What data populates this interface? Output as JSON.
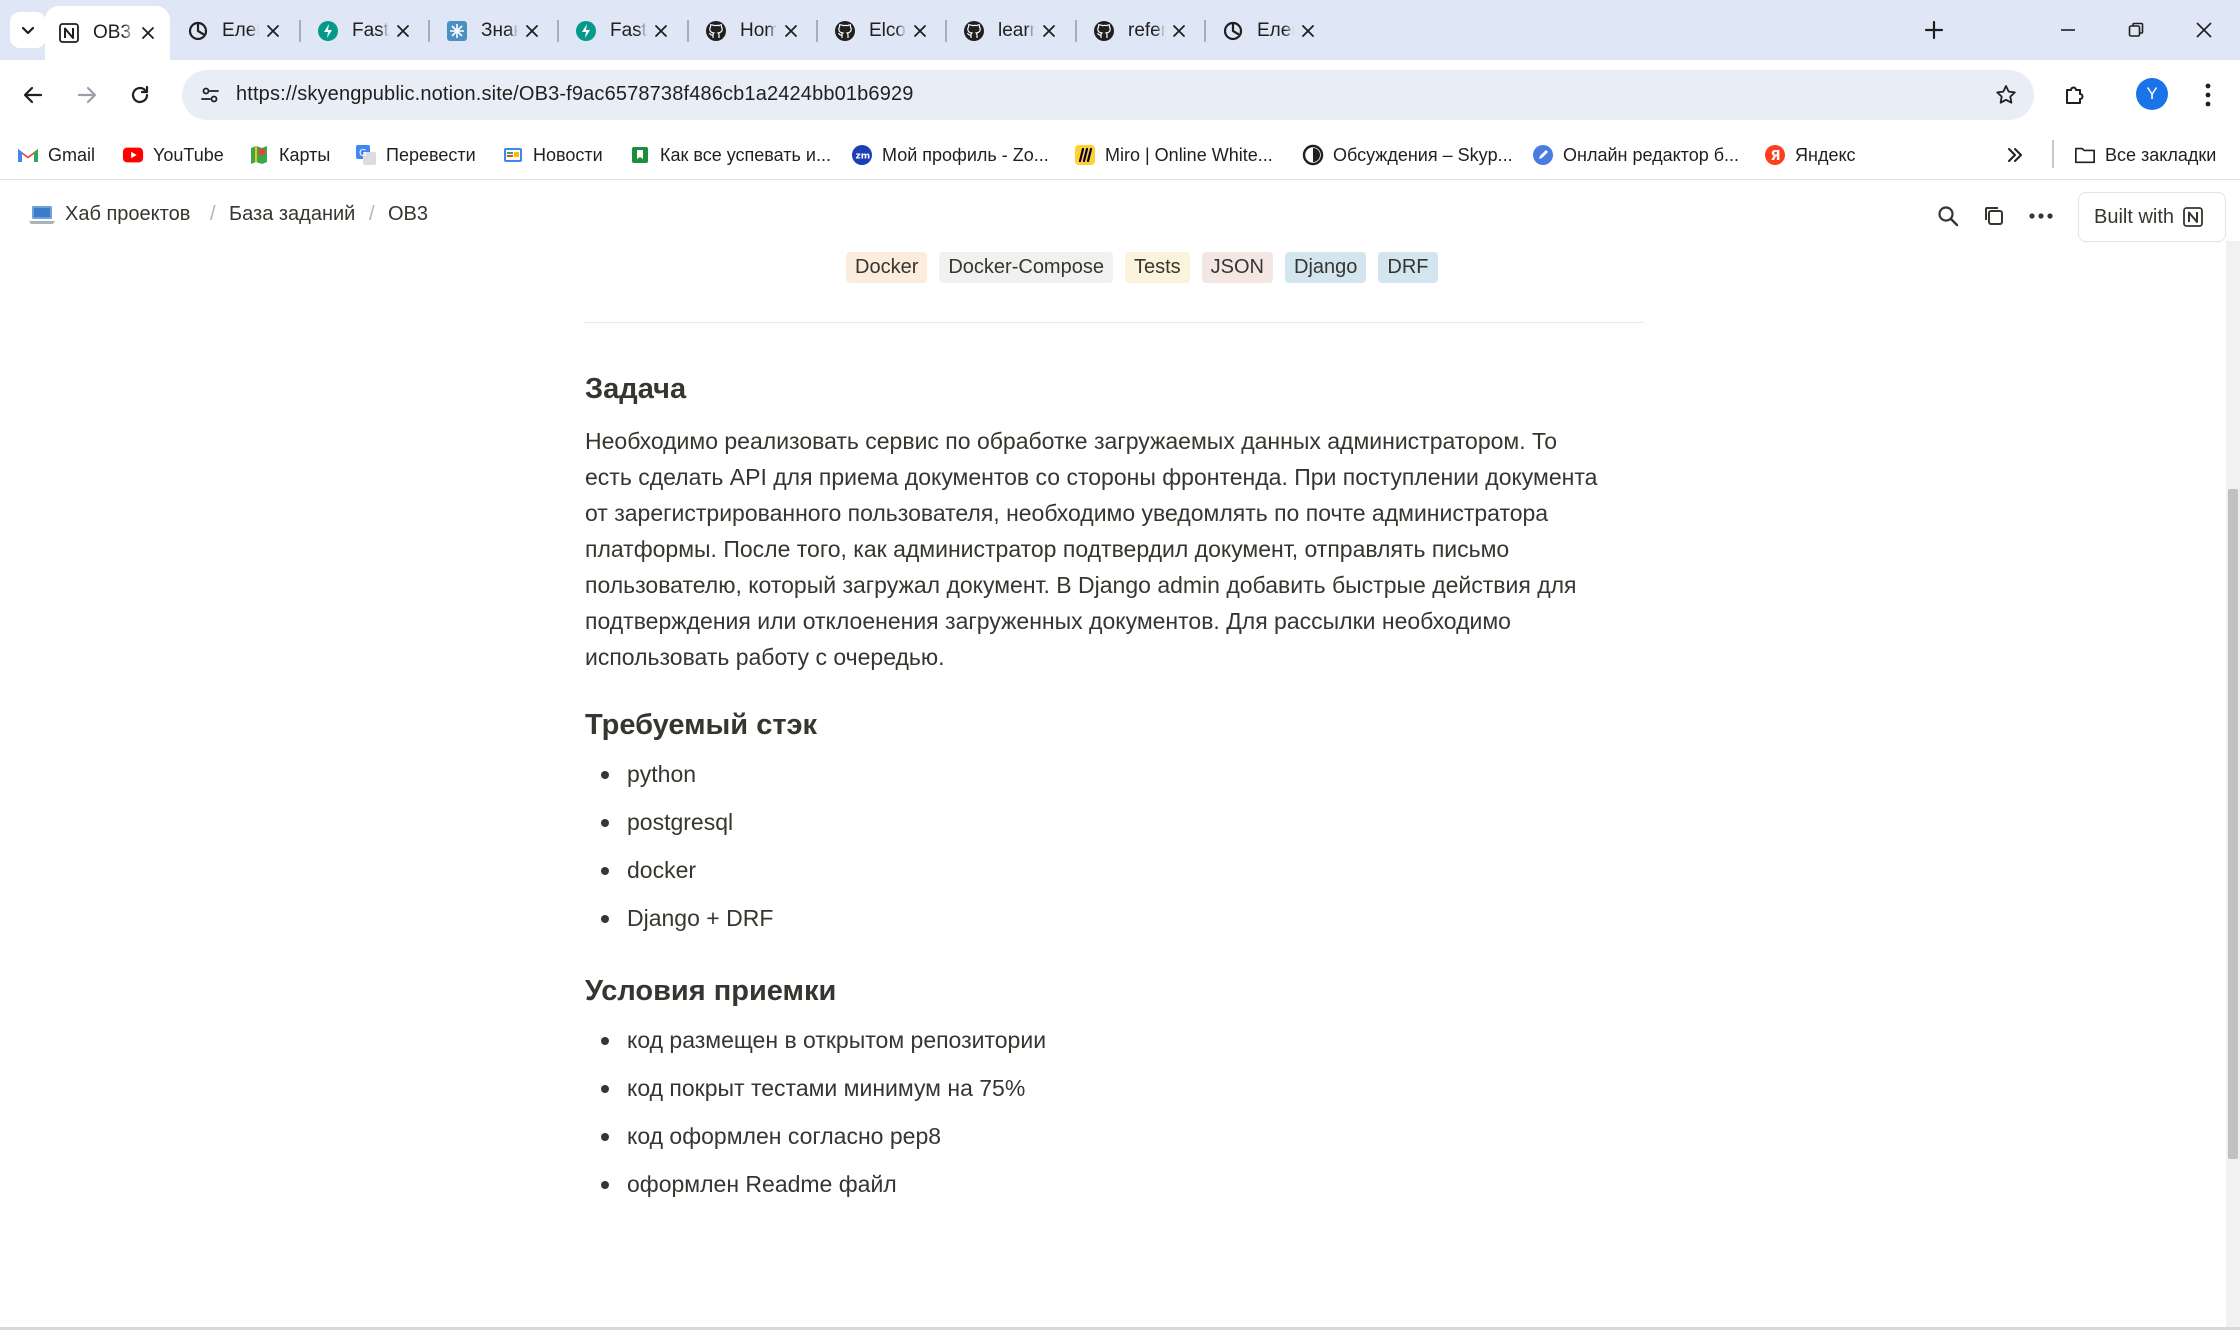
{
  "browser": {
    "tabs": [
      {
        "title": "OB3",
        "icon": "notion-icon",
        "active": true
      },
      {
        "title": "Елена Бан",
        "icon": "timer-icon"
      },
      {
        "title": "FastAPI",
        "icon": "fastapi-icon"
      },
      {
        "title": "Знакомств",
        "icon": "puzzle-icon"
      },
      {
        "title": "FastAPI",
        "icon": "fastapi-icon"
      },
      {
        "title": "Homewor",
        "icon": "github-icon"
      },
      {
        "title": "Elcom_AP",
        "icon": "github-icon"
      },
      {
        "title": "learning_p",
        "icon": "github-icon"
      },
      {
        "title": "referral_p",
        "icon": "github-icon"
      },
      {
        "title": "Елена Бан",
        "icon": "timer-icon"
      }
    ],
    "url": "https://skyengpublic.notion.site/OB3-f9ac6578738f486cb1a2424bb01b6929",
    "profile_initial": "Y",
    "bookmarks": [
      {
        "label": "Gmail",
        "icon": "gmail-icon"
      },
      {
        "label": "YouTube",
        "icon": "youtube-icon"
      },
      {
        "label": "Карты",
        "icon": "maps-icon"
      },
      {
        "label": "Перевести",
        "icon": "translate-icon"
      },
      {
        "label": "Новости",
        "icon": "news-icon"
      },
      {
        "label": "Как все успевать и...",
        "icon": "bookmark-icon"
      },
      {
        "label": "Мой профиль - Zo...",
        "icon": "zoom-icon"
      },
      {
        "label": "Miro | Online White...",
        "icon": "miro-icon"
      },
      {
        "label": "Обсуждения – Skyp...",
        "icon": "skypro-icon"
      },
      {
        "label": "Онлайн редактор б...",
        "icon": "editor-icon"
      },
      {
        "label": "Яндекс",
        "icon": "yandex-icon"
      }
    ],
    "all_bookmarks": "Все закладки"
  },
  "notion": {
    "breadcrumbs": [
      "Хаб проектов",
      "База заданий",
      "OB3"
    ],
    "built_with": "Built with",
    "tags": [
      {
        "label": "Docker",
        "color": "#fbecdd"
      },
      {
        "label": "Docker-Compose",
        "color": "#f1f1ef"
      },
      {
        "label": "Tests",
        "color": "#fbf3db"
      },
      {
        "label": "JSON",
        "color": "#f4e7e3"
      },
      {
        "label": "Django",
        "color": "#d3e5ef"
      },
      {
        "label": "DRF",
        "color": "#d3e5ef"
      }
    ],
    "task_heading": "Задача",
    "task_lines": [
      "Необходимо реализовать сервис по обработке загружаемых данных администратором. То",
      "есть сделать API для приема документов со стороны фронтенда. При поступлении документа",
      "от зарегистрированного пользователя, необходимо уведомлять по почте администратора",
      "платформы. После того, как администратор подтвердил документ, отправлять письмо",
      "пользователю, который загружал документ. В Django admin добавить быстрые действия для",
      "подтверждения или отклоенения загруженных документов. Для рассылки необходимо",
      "использовать работу с очередью."
    ],
    "stack_heading": "Требуемый стэк",
    "stack_items": [
      "python",
      "postgresql",
      "docker",
      "Django + DRF"
    ],
    "accept_heading": "Условия приемки",
    "accept_items": [
      "код размещен в открытом репозитории",
      "код покрыт тестами минимум на 75%",
      "код оформлен согласно pep8",
      "оформлен Readme файл"
    ]
  }
}
